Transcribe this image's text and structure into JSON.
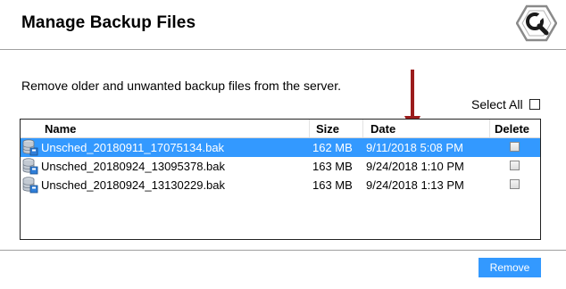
{
  "header": {
    "title": "Manage Backup Files",
    "logo_icon": "wrench-gear-icon"
  },
  "description": "Remove older and unwanted backup files from the server.",
  "select_all": {
    "label": "Select All",
    "checked": false
  },
  "table": {
    "columns": [
      "Name",
      "Size",
      "Date",
      "Delete"
    ],
    "rows": [
      {
        "name": "Unsched_20180911_17075134.bak",
        "size": "162 MB",
        "date": "9/11/2018 5:08 PM",
        "delete": false,
        "selected": true
      },
      {
        "name": "Unsched_20180924_13095378.bak",
        "size": "163 MB",
        "date": "9/24/2018 1:10 PM",
        "delete": false,
        "selected": false
      },
      {
        "name": "Unsched_20180924_13130229.bak",
        "size": "163 MB",
        "date": "9/24/2018 1:13 PM",
        "delete": false,
        "selected": false
      }
    ]
  },
  "footer": {
    "remove_label": "Remove"
  },
  "colors": {
    "accent": "#3399ff",
    "arrow": "#9b1c1c"
  }
}
